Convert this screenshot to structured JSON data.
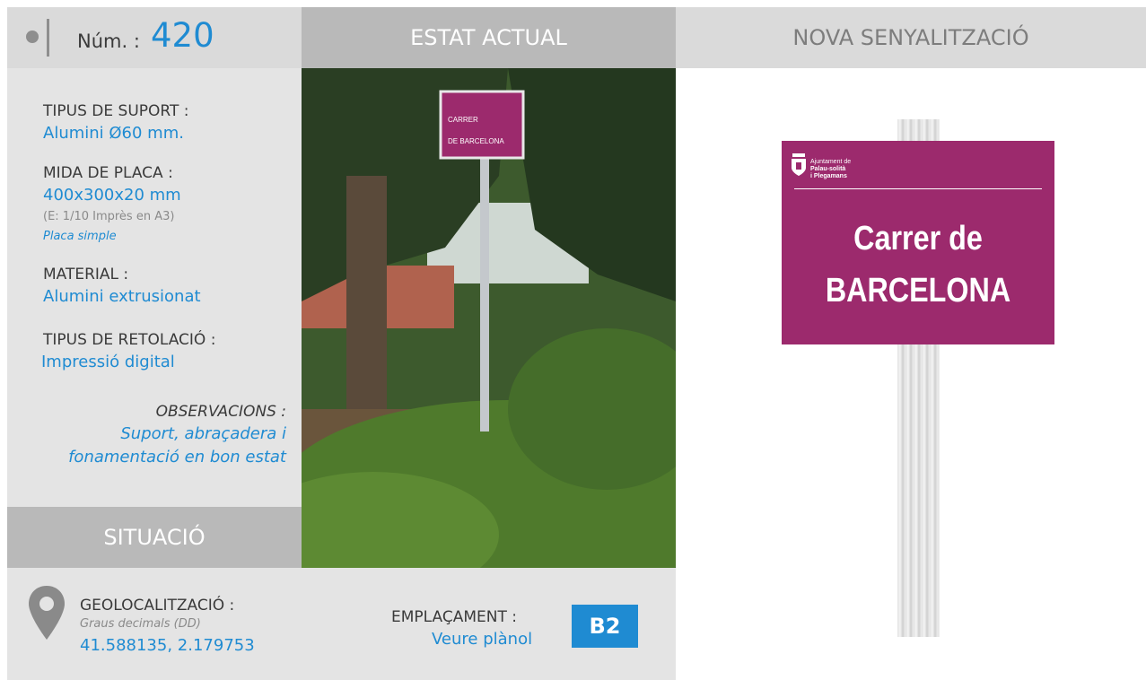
{
  "header": {
    "num_label": "Núm. :",
    "num_value": "420",
    "current_state": "ESTAT ACTUAL",
    "new_signage": "NOVA SENYALITZACIÓ"
  },
  "details": {
    "support_label": "TIPUS DE SUPORT :",
    "support_value": "Alumini Ø60 mm.",
    "plate_label": "MIDA DE PLACA :",
    "plate_value": "400x300x20 mm",
    "plate_scale": "(E: 1/10 Imprès en A3)",
    "plate_type": "Placa simple",
    "material_label": "MATERIAL :",
    "material_value": "Alumini extrusionat",
    "lettering_label": "TIPUS DE RETOLACIÓ :",
    "lettering_value": "Impressió digital",
    "observations_label": "OBSERVACIONS :",
    "observations_line1": "Suport, abraçadera i",
    "observations_line2": "fonamentació en bon estat"
  },
  "situation": {
    "title": "SITUACIÓ",
    "geo_label": "GEOLOCALITZACIÓ :",
    "geo_format": "Graus decimals (DD)",
    "geo_value": "41.588135, 2.179753",
    "location_label": "EMPLAÇAMENT :",
    "location_link": "Veure plànol",
    "location_code": "B2"
  },
  "photo_sign": {
    "line1": "CARRER",
    "line2": "DE BARCELONA"
  },
  "new_sign": {
    "org_line1": "Ajuntament de",
    "org_line2": "Palau-solità",
    "org_line3": "i Plegamans",
    "line1": "Carrer de",
    "line2": "BARCELONA",
    "color": "#9c2a6d"
  },
  "colors": {
    "accent": "#1f8bd2",
    "header_dark": "#b9b9b9",
    "header_light": "#dadada"
  }
}
